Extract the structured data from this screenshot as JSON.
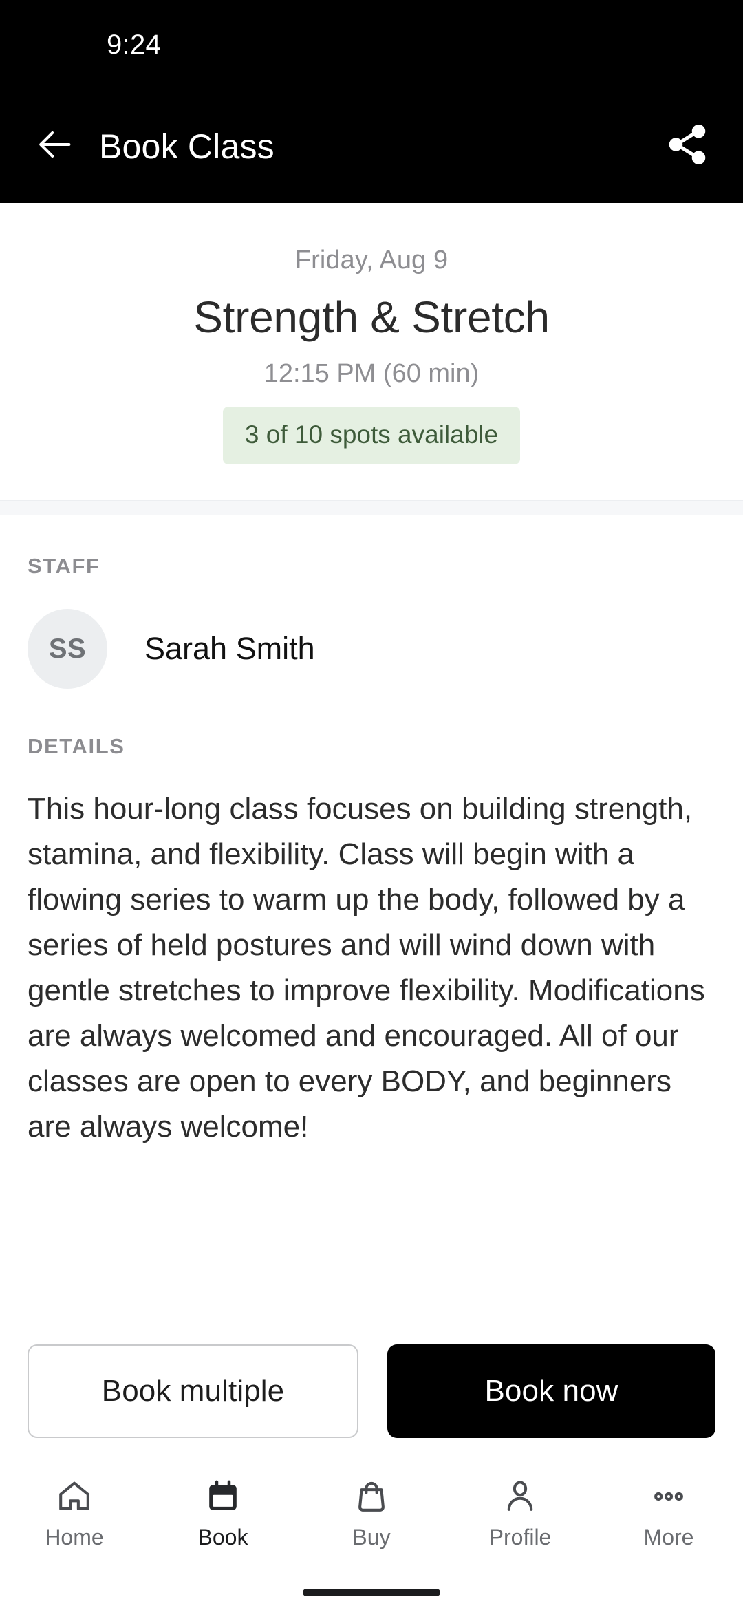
{
  "status_bar": {
    "time": "9:24"
  },
  "app_bar": {
    "title": "Book Class",
    "back_icon": "arrow-left-icon",
    "share_icon": "share-icon"
  },
  "hero": {
    "date": "Friday, Aug 9",
    "title": "Strength & Stretch",
    "time": "12:15 PM (60 min)",
    "availability": "3 of 10 spots available",
    "availability_bg": "#e5f0e2",
    "availability_color": "#3e5b3a"
  },
  "staff": {
    "section_label": "STAFF",
    "initials": "SS",
    "name": "Sarah Smith"
  },
  "details": {
    "section_label": "DETAILS",
    "text": "This hour-long class focuses on building strength, stamina, and flexibility. Class will begin with a flowing series to warm up the body, followed by a series of held postures and will wind down with gentle stretches to improve flexibility. Modifications are always welcomed and encouraged. All of our classes are open to every BODY, and beginners are always welcome!"
  },
  "actions": {
    "secondary_label": "Book multiple",
    "primary_label": "Book now",
    "primary_bg": "#000000",
    "primary_color": "#ffffff"
  },
  "bottom_nav": {
    "items": [
      {
        "label": "Home",
        "icon": "home-icon",
        "active": false
      },
      {
        "label": "Book",
        "icon": "calendar-icon",
        "active": true
      },
      {
        "label": "Buy",
        "icon": "bag-icon",
        "active": false
      },
      {
        "label": "Profile",
        "icon": "person-icon",
        "active": false
      },
      {
        "label": "More",
        "icon": "ellipsis-icon",
        "active": false
      }
    ]
  }
}
